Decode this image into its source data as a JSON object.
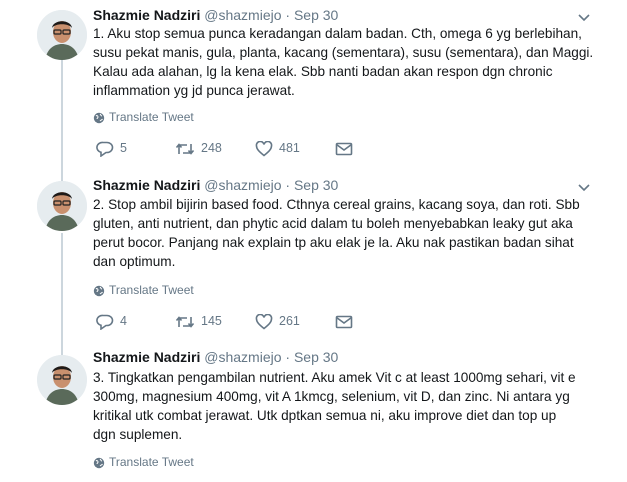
{
  "tweets": [
    {
      "display_name": "Shazmie Nadziri",
      "handle": "@shazmiejo",
      "separator": "·",
      "date": "Sep 30",
      "text": "1. Aku stop semua punca keradangan dalam badan. Cth, omega 6 yg berlebihan,\nsusu pekat manis, gula, planta, kacang (sementara), susu (sementara), dan Maggi.\nKalau ada alahan, lg la kena elak. Sbb nanti badan akan respon dgn chronic\ninflammation yg jd punca jerawat.",
      "translate_label": "Translate Tweet",
      "replies": "5",
      "retweets": "248",
      "likes": "481"
    },
    {
      "display_name": "Shazmie Nadziri",
      "handle": "@shazmiejo",
      "separator": "·",
      "date": "Sep 30",
      "text": "2. Stop ambil bijirin based food. Cthnya cereal grains, kacang soya, dan roti. Sbb\ngluten, anti nutrient, dan phytic acid dalam tu boleh menyebabkan leaky gut aka\nperut bocor. Panjang nak explain tp aku elak je la. Aku nak pastikan badan sihat\ndan optimum.",
      "translate_label": "Translate Tweet",
      "replies": "4",
      "retweets": "145",
      "likes": "261"
    },
    {
      "display_name": "Shazmie Nadziri",
      "handle": "@shazmiejo",
      "separator": "·",
      "date": "Sep 30",
      "text": "3. Tingkatkan pengambilan nutrient. Aku amek Vit c at least 1000mg sehari, vit e\n300mg, magnesium 400mg, vit A 1kmcg, selenium, vit D, dan zinc. Ni antara yg\nkritikal utk combat jerawat. Utk dptkan semua ni, aku improve diet dan top up\ndgn suplemen.",
      "translate_label": "Translate Tweet"
    }
  ],
  "colors": {
    "text": "#14171a",
    "muted": "#657786",
    "thread_line": "#ccd6dd"
  },
  "icons": [
    "avatar",
    "chevron-down-icon",
    "globe-icon",
    "reply-icon",
    "retweet-icon",
    "like-icon",
    "direct-message-icon"
  ]
}
